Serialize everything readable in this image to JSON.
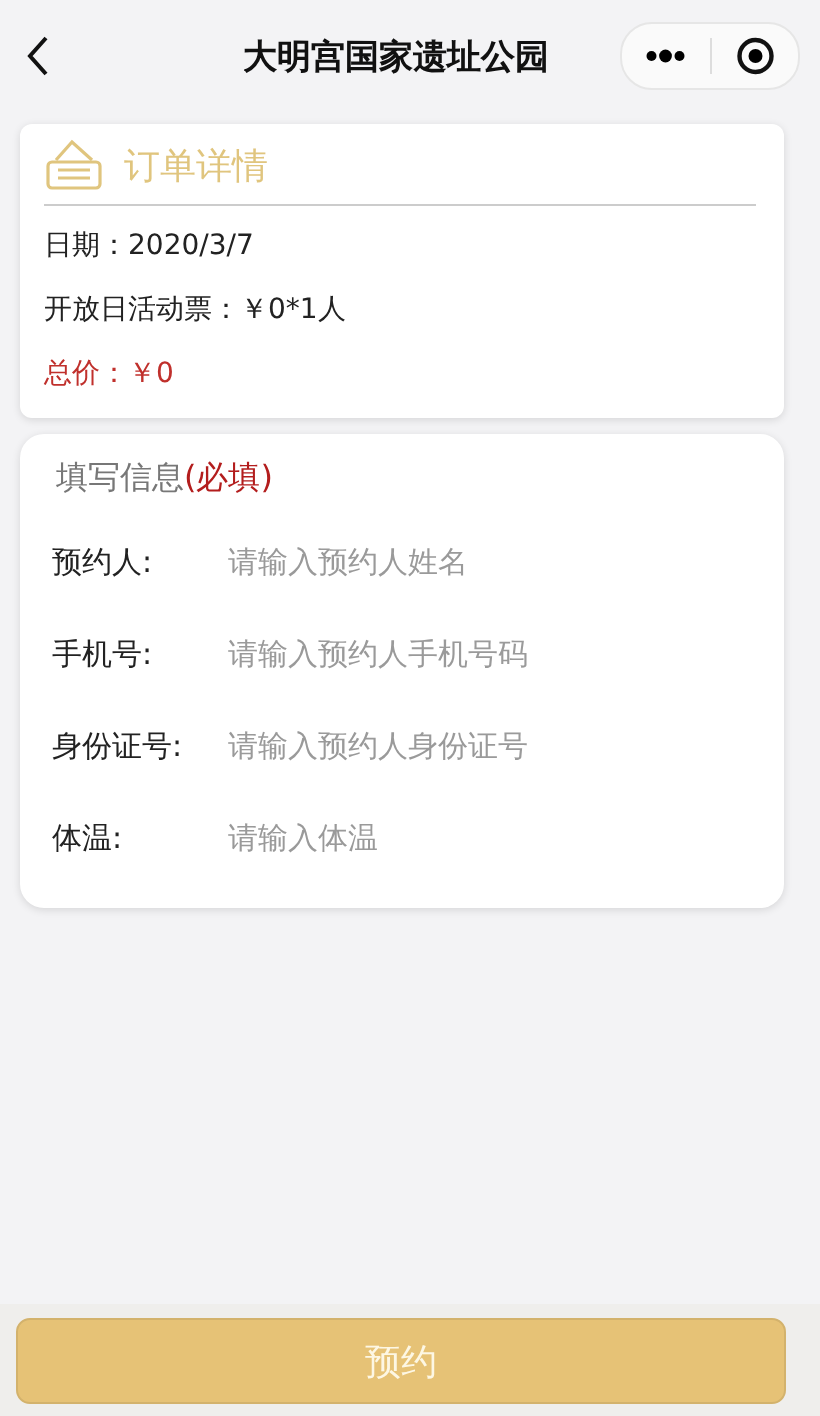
{
  "nav_bar": {
    "title": "大明宫国家遗址公园"
  },
  "order_card": {
    "title": "订单详情",
    "lines": [
      {
        "kind": "plain",
        "label": "日期：",
        "value": "2020/3/7"
      },
      {
        "kind": "plain",
        "label": "开放日活动票：",
        "value": "￥0*1人"
      },
      {
        "kind": "total",
        "label": "总价：",
        "value": "￥0"
      }
    ]
  },
  "form_card": {
    "title": "填写信息",
    "required_mark": "(必填)",
    "fields": [
      {
        "label": "预约人:",
        "placeholder": "请输入预约人姓名"
      },
      {
        "label": "手机号:",
        "placeholder": "请输入预约人手机号码"
      },
      {
        "label": "身份证号:",
        "placeholder": "请输入预约人身份证号"
      },
      {
        "label": "体温:",
        "placeholder": "请输入体温"
      }
    ]
  },
  "submit_button": {
    "label": "预约"
  }
}
